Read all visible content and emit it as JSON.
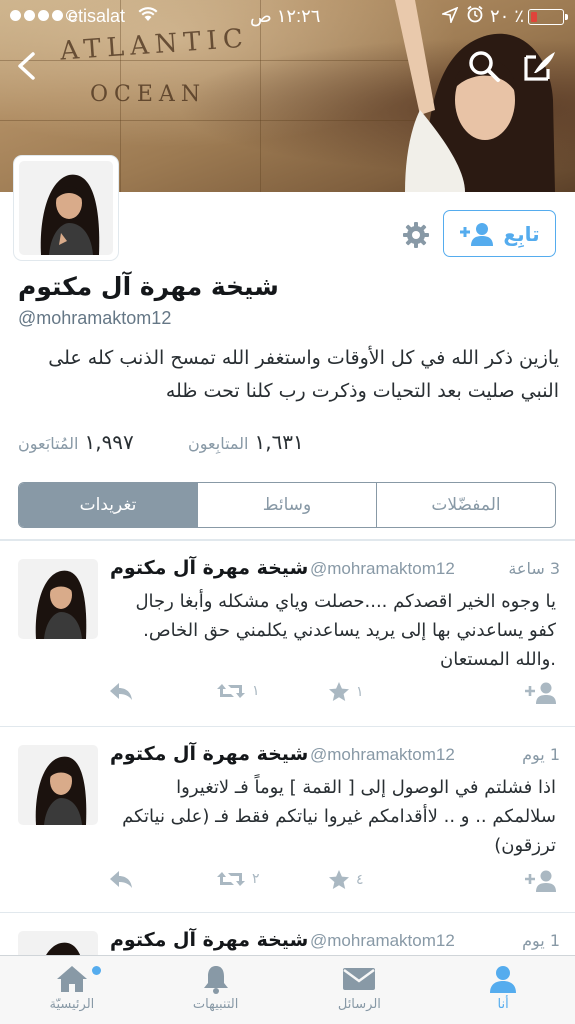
{
  "status_bar": {
    "carrier": "etisalat",
    "time": "١٢:٢٦ ص",
    "battery_pct": "٢٠ ٪",
    "signal_dots_filled": 4
  },
  "header": {
    "banner_map_words": [
      "ATLANTIC",
      "OCEAN"
    ]
  },
  "profile": {
    "name": "شيخة مهرة آل مكتوم",
    "handle": "@mohramaktom12",
    "bio": "يازين ذكر الله في كل الأوقات واستغفر الله تمسح الذنب كله على النبي صليت بعد التحيات وذكرت رب كلنا تحت ظله",
    "following_count": "١,٦٣١",
    "following_label": "المتابِعون",
    "followers_count": "١,٩٩٧",
    "followers_label": "المُتابَعون",
    "follow_button": "تابِع"
  },
  "tabs": {
    "tweets": "تغريدات",
    "media": "وسائط",
    "favorites": "المفضّلات",
    "active": "tweets"
  },
  "tweets": [
    {
      "name": "شيخة مهرة آل مكتوم",
      "handle": "@mohramaktom12",
      "time": "3 ساعة",
      "text": "يا وجوه الخير اقصدكم ....حصلت وياي مشكله وأبغا رجال كفو يساعدني بها إلى يريد يساعدني يكلمني حق الخاص. .والله المستعان",
      "retweets": "١",
      "favorites": "١"
    },
    {
      "name": "شيخة مهرة آل مكتوم",
      "handle": "@mohramaktom12",
      "time": "1 يوم",
      "text": "اذا فشلتم في الوصول إلى [ القمة ] يوماً فـ لاتغيروا سلالمكم .. و .. لاأقدامكم غيروا نياتكم فقط فـ (على نياتكم ترزقون)",
      "retweets": "٢",
      "favorites": "٤"
    },
    {
      "name": "شيخة مهرة آل مكتوم",
      "handle": "@mohramaktom12",
      "time": "1 يوم",
      "text": ""
    }
  ],
  "tabbar": {
    "home": "الرئيسيّة",
    "notifications": "التنبيهات",
    "messages": "الرسائل",
    "me": "أنا",
    "active": "me"
  },
  "colors": {
    "accent": "#55acee",
    "muted": "#8899a6",
    "text": "#292f33"
  }
}
